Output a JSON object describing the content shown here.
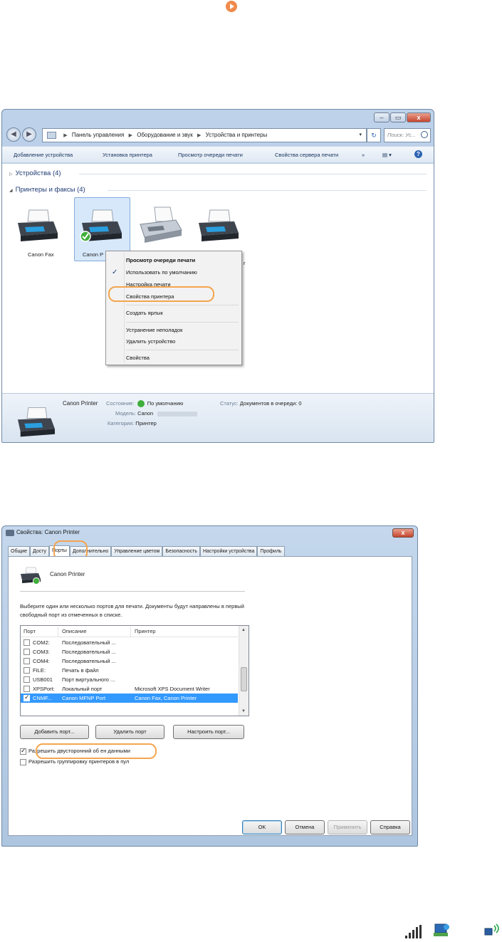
{
  "window1": {
    "caption_buttons": [
      "–",
      "▭",
      "x"
    ],
    "breadcrumb": [
      "Панель управления",
      "Оборудование и звук",
      "Устройства и принтеры"
    ],
    "search_placeholder": "Поиск: Ус...",
    "toolbar": [
      "Добавление устройства",
      "Установка принтера",
      "Просмотр очереди печати",
      "Свойства сервера печати",
      "»"
    ],
    "view_menu": "▤ ▾",
    "help": "?",
    "groups": {
      "devices": "Устройства (4)",
      "printers": "Принтеры и факсы (4)"
    },
    "printers": [
      {
        "label": "Canon Fax"
      },
      {
        "label": "Canon P"
      },
      {
        "label": ""
      },
      {
        "label": "r"
      }
    ],
    "context_menu": {
      "items": [
        {
          "label": "Просмотр очереди печати",
          "bold": true
        },
        {
          "label": "Использовать по умолчанию",
          "checked": true
        },
        {
          "label": "Настройка печати"
        },
        {
          "label": "Свойства принтера"
        },
        {
          "label": "Создать ярлык"
        },
        {
          "label": "Устранение неполадок"
        },
        {
          "label": "Удалить устройство"
        },
        {
          "label": "Свойства"
        }
      ]
    },
    "details": {
      "name": "Canon Printer",
      "state_key": "Состояние:",
      "state_val": "По умолчанию",
      "status_key": "Статус:",
      "status_val": "Документов в очереди: 0",
      "model_key": "Модель:",
      "model_val": "Canon",
      "category_key": "Категория:",
      "category_val": "Принтер"
    }
  },
  "window2": {
    "title": "Свойства: Canon Printer",
    "tabs": [
      "Общие",
      "Досту",
      "Порты",
      "Дополнительно",
      "Управление цветом",
      "Безопасность",
      "Настройки устройства",
      "Профиль"
    ],
    "active_tab": 2,
    "printer_name": "Canon Printer",
    "instructions": "Выберите один или несколько портов для печати. Документы будут направлены в первый свободный порт из отмеченных в списке.",
    "columns": [
      "Порт",
      "Описание",
      "Принтер"
    ],
    "ports": [
      {
        "port": "COM2:",
        "desc": "Последовательный ...",
        "printer": "",
        "checked": false,
        "selected": false
      },
      {
        "port": "COM3:",
        "desc": "Последовательный ...",
        "printer": "",
        "checked": false,
        "selected": false
      },
      {
        "port": "COM4:",
        "desc": "Последовательный ...",
        "printer": "",
        "checked": false,
        "selected": false
      },
      {
        "port": "FILE:",
        "desc": "Печать в файл",
        "printer": "",
        "checked": false,
        "selected": false
      },
      {
        "port": "USB001",
        "desc": "Порт виртуального ...",
        "printer": "",
        "checked": false,
        "selected": false
      },
      {
        "port": "XPSPort:",
        "desc": "Локальный порт",
        "printer": "Microsoft XPS Document Writer",
        "checked": false,
        "selected": false
      },
      {
        "port": "CNMF...",
        "desc": "Canon MFNP Port",
        "printer": "Canon Fax, Canon Printer",
        "checked": true,
        "selected": true
      }
    ],
    "buttons": {
      "add_port": "Добавить порт...",
      "delete_port": "Удалить порт",
      "configure_port": "Настроить порт..."
    },
    "options": [
      {
        "label": "Разрешить двусторонний об  ен данными",
        "checked": true
      },
      {
        "label": "Разрешить группировку принтеров в пул",
        "checked": false
      }
    ],
    "footer": {
      "ok": "OK",
      "cancel": "Отмена",
      "apply": "Применить",
      "help": "Справка"
    },
    "close": "x"
  },
  "colors": {
    "highlight": "#f4a64f",
    "selection": "#3399ff",
    "bullet": "#f08a4b"
  }
}
